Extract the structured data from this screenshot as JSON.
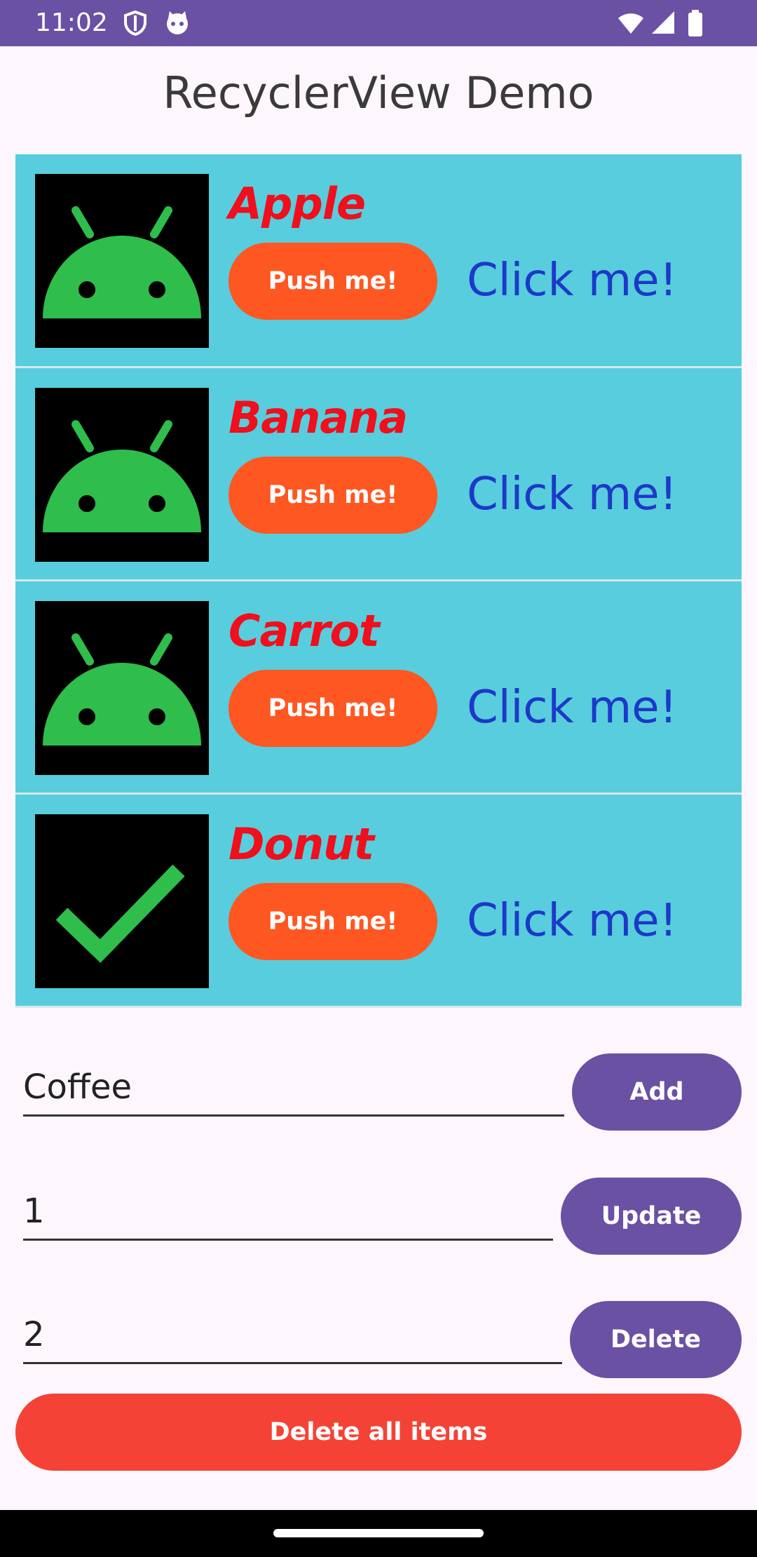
{
  "status_bar": {
    "time": "11:02",
    "left_icons": [
      "shield-icon",
      "cat-face-icon"
    ],
    "right_icons": [
      "wifi-icon",
      "signal-icon",
      "battery-icon"
    ]
  },
  "app_title": "RecyclerView Demo",
  "items": [
    {
      "name": "Apple",
      "push_label": "Push me!",
      "click_label": "Click me!",
      "icon": "android-icon"
    },
    {
      "name": "Banana",
      "push_label": "Push me!",
      "click_label": "Click me!",
      "icon": "android-icon"
    },
    {
      "name": "Carrot",
      "push_label": "Push me!",
      "click_label": "Click me!",
      "icon": "android-icon"
    },
    {
      "name": "Donut",
      "push_label": "Push me!",
      "click_label": "Click me!",
      "icon": "checkmark-icon"
    }
  ],
  "add_form": {
    "value": "Coffee",
    "button_label": "Add"
  },
  "update_form": {
    "value": "1",
    "button_label": "Update"
  },
  "delete_form": {
    "value": "2",
    "button_label": "Delete"
  },
  "delete_all_label": "Delete all items",
  "colors": {
    "status_bar": "#6a51a4",
    "row_bg": "#58cddd",
    "item_name": "#f00f1c",
    "push_button": "#ff5722",
    "click_link": "#1c39c8",
    "primary_button": "#6a51a4",
    "delete_all_button": "#f44336",
    "android_green": "#2fbd4b"
  }
}
